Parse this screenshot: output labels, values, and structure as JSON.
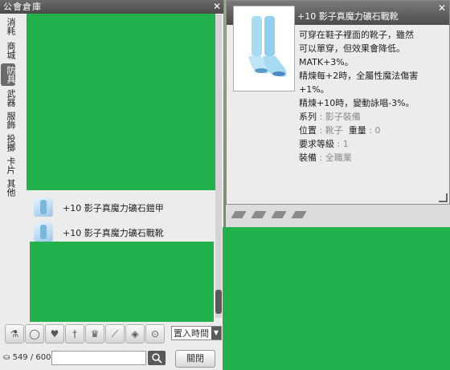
{
  "storage": {
    "title": "公會倉庫",
    "tabs": [
      "消耗",
      "商城",
      "防具",
      "武器",
      "服飾",
      "投擲",
      "卡片",
      "其他"
    ],
    "active_tab": "防具",
    "items": [
      {
        "name": "+10 影子真魔力礦石鎧甲",
        "icon": "armor-icon"
      },
      {
        "name": "+10 影子真魔力礦石戰靴",
        "icon": "boots-icon"
      }
    ],
    "filter_icons": [
      "potion-icon",
      "ring-icon",
      "armor-icon",
      "sword-icon",
      "crown-icon",
      "wand-icon",
      "card-icon",
      "compass-icon"
    ],
    "sort_value": "置入時間",
    "count": "549 / 600",
    "search_placeholder": "",
    "close_label": "關閉"
  },
  "item_info": {
    "title": "+10 影子真魔力礦石戰靴",
    "lines": [
      "可穿在鞋子裡面的靴子，雖然",
      "可以單穿，但效果會降低。",
      "MATK+3%。",
      "精煉每+2時，全屬性魔法傷害",
      "+1%。",
      "精煉+10時，變動詠唱-3%。"
    ],
    "props": [
      {
        "label": "系列",
        "value": "影子裝備"
      },
      {
        "label": "位置",
        "value": "靴子",
        "label2": "重量",
        "value2": "0"
      },
      {
        "label": "要求等級",
        "value": "1"
      },
      {
        "label": "裝備",
        "value": "全職業"
      }
    ]
  },
  "colors": {
    "accent_green": "#22b14c",
    "titlebar": "#4a4a4a"
  }
}
